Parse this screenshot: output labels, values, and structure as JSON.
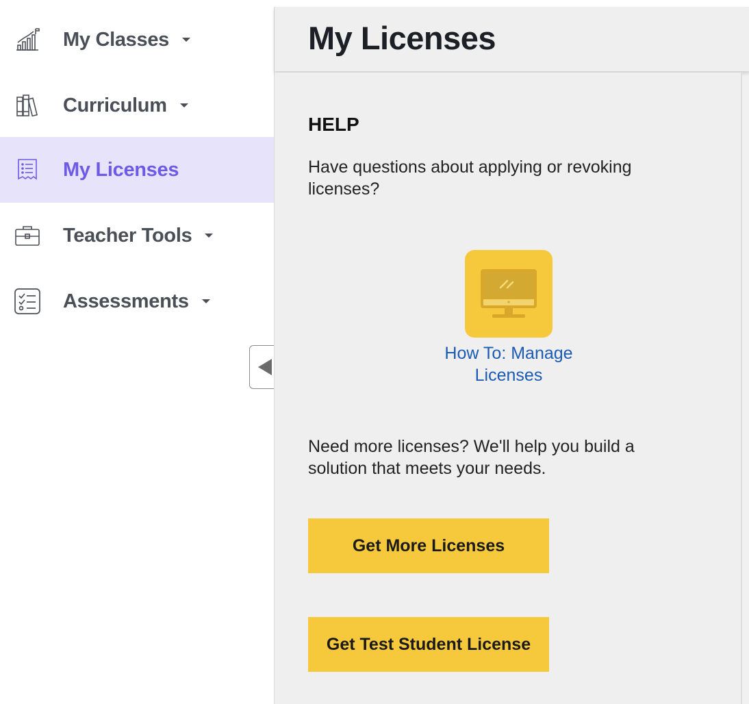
{
  "sidebar": {
    "items": [
      {
        "label": "My Classes",
        "icon": "chart-growth-icon",
        "has_dropdown": true,
        "active": false
      },
      {
        "label": "Curriculum",
        "icon": "books-icon",
        "has_dropdown": true,
        "active": false
      },
      {
        "label": "My Licenses",
        "icon": "license-document-icon",
        "has_dropdown": false,
        "active": true
      },
      {
        "label": "Teacher Tools",
        "icon": "briefcase-icon",
        "has_dropdown": true,
        "active": false
      },
      {
        "label": "Assessments",
        "icon": "checklist-icon",
        "has_dropdown": true,
        "active": false
      }
    ],
    "collapse_icon": "collapse-left-icon"
  },
  "header": {
    "title": "My Licenses"
  },
  "help": {
    "heading": "HELP",
    "question": "Have questions about applying or revoking licenses?",
    "video_icon": "monitor-icon",
    "video_link": "How To: Manage Licenses",
    "need_more": "Need more licenses? We'll help you build a solution that meets your needs.",
    "get_more_button": "Get More Licenses",
    "test_student_button": "Get Test Student License"
  },
  "colors": {
    "accent": "#6e5ae6",
    "active_bg": "#e6e3fb",
    "button_yellow": "#f6c83b",
    "link_blue": "#1a5bb5",
    "nav_text": "#4a4f57"
  }
}
